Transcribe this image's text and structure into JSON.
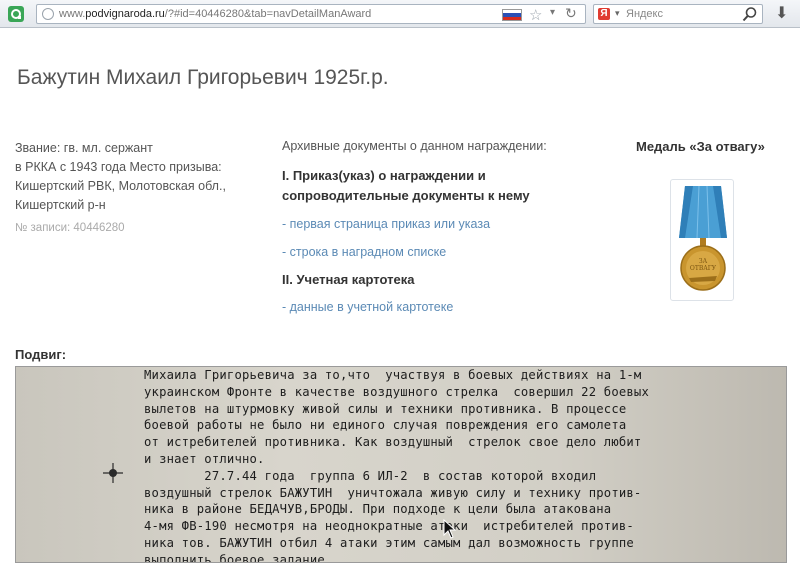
{
  "browser": {
    "url_prefix": "www.",
    "url_domain": "podvignaroda.ru",
    "url_rest": "/?#id=40446280&tab=navDetailManAward",
    "search_placeholder": "Яндекс",
    "search_engine_letter": "Я",
    "icons": [
      "app-icon",
      "globe-icon",
      "russia-flag-icon",
      "star-icon",
      "dropdown-icon",
      "reload-icon",
      "yandex-icon",
      "search-icon",
      "download-icon"
    ]
  },
  "person": {
    "title": "Бажутин Михаил Григорьевич 1925г.р.",
    "details": [
      "Звание: гв. мл. сержант",
      "в РККА с 1943 года Место призыва:",
      "Кишертский РВК, Молотовская обл.,",
      "Кишертский р-н"
    ],
    "record_no": "№ записи: 40446280"
  },
  "archive": {
    "heading": "Архивные документы о данном награждении:",
    "section1_title_line1": "I. Приказ(указ) о награждении и",
    "section1_title_line2": "сопроводительные документы к нему",
    "link_first_page": "- первая страница приказ или указа",
    "link_award_list": "- строка в наградном списке",
    "section2_title": "II. Учетная картотека",
    "link_card_data": "- данные в учетной картотеке"
  },
  "medal": {
    "title": "Медаль «За отвагу»",
    "ribbon_color": "#4a9fd4",
    "medal_color": "#c9952e"
  },
  "feat": {
    "label": "Подвиг:",
    "lines": [
      "Михаила Григорьевича за то,что  участвуя в боевых действиях на 1-м",
      "украинском Фронте в качестве воздушного стрелка  совершил 22 боевых",
      "вылетов на штурмовку живой силы и техники противника. В процессе",
      "боевой работы не было ни единого случая повреждения его самолета",
      "от истребителей противника. Как воздушный  стрелок свое дело любит",
      "и знает отлично.",
      "        27.7.44 года  группа 6 ИЛ-2  в состав которой входил",
      "воздушный стрелок БАЖУТИН  уничтожала живую силу и технику против-",
      "ника в районе БЕДАЧУВ,БРОДЫ. При подходе к цели была атакована",
      "4-мя ФВ-190 несмотря на неоднократные атаки  истребителей против-",
      "ника тов. БАЖУТИН отбил 4 атаки этим самым дал возможность группе",
      "выполнить боевое задание."
    ]
  }
}
